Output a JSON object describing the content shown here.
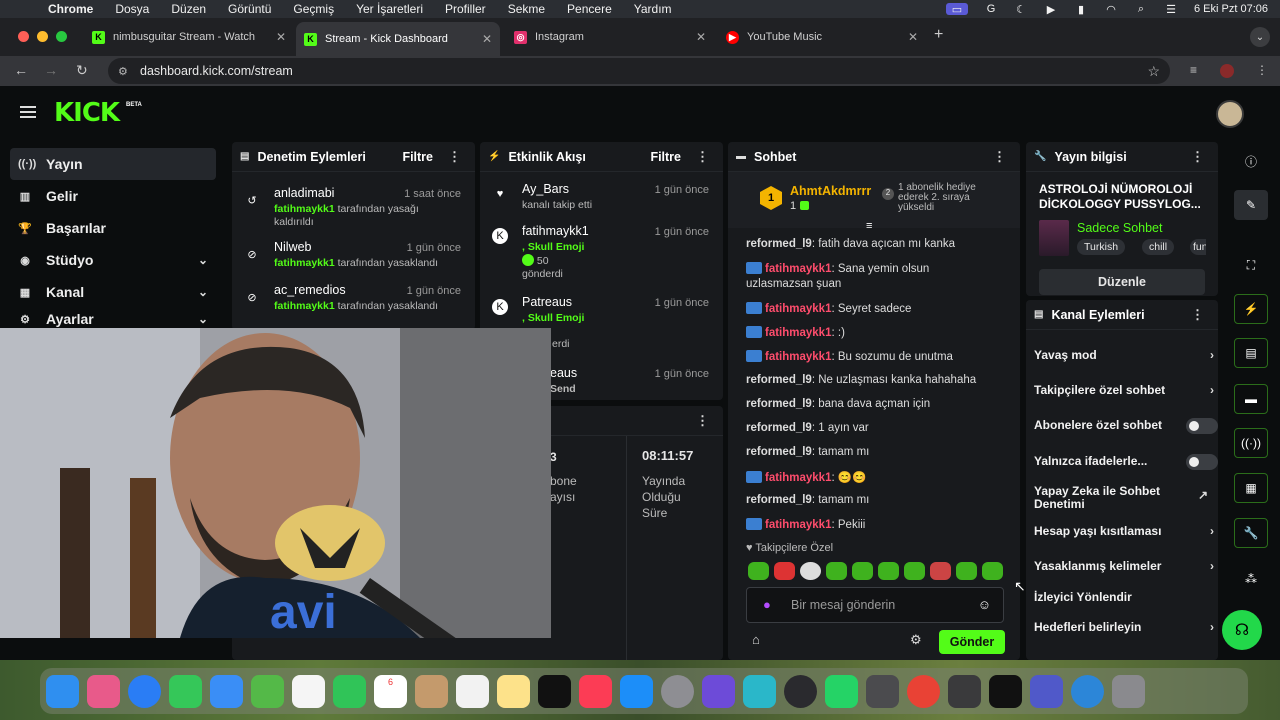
{
  "menubar": {
    "app": "Chrome",
    "items": [
      "Dosya",
      "Düzen",
      "Görüntü",
      "Geçmiş",
      "Yer İşaretleri",
      "Profiller",
      "Sekme",
      "Pencere",
      "Yardım"
    ],
    "datetime": "6 Eki Pzt 07:06"
  },
  "tabs": [
    {
      "title": "nimbusguitar Stream - Watch",
      "favicon": "K",
      "color": "#53fc18"
    },
    {
      "title": "Stream - Kick Dashboard",
      "favicon": "K",
      "color": "#53fc18"
    },
    {
      "title": "Instagram",
      "favicon": "◎",
      "color": "#e1306c"
    },
    {
      "title": "YouTube Music",
      "favicon": "▶",
      "color": "#ff0000"
    }
  ],
  "address": {
    "url": "dashboard.kick.com/stream"
  },
  "brand": {
    "logo": "KICK",
    "beta": "BETA",
    "accent": "#53fc18"
  },
  "sidebar": {
    "items": [
      {
        "label": "Yayın",
        "icon": "broadcast-icon"
      },
      {
        "label": "Gelir",
        "icon": "chart-icon"
      },
      {
        "label": "Başarılar",
        "icon": "trophy-icon"
      },
      {
        "label": "Stüdyo",
        "icon": "studio-icon"
      },
      {
        "label": "Kanal",
        "icon": "channel-icon"
      },
      {
        "label": "Ayarlar",
        "icon": "gear-icon"
      }
    ]
  },
  "moderation": {
    "title": "Denetim Eylemleri",
    "filter": "Filtre",
    "rows": [
      {
        "name": "anladimabi",
        "time": "1 saat önce",
        "actor": "fatihmaykk1",
        "text": " tarafından yasağı kaldırıldı"
      },
      {
        "name": "Nilweb",
        "time": "1 gün önce",
        "actor": "fatihmaykk1",
        "text": " tarafından yasaklandı"
      },
      {
        "name": "ac_remedios",
        "time": "1 gün önce",
        "actor": "fatihmaykk1",
        "text": " tarafından yasaklandı"
      }
    ]
  },
  "activity": {
    "title": "Etkinlik Akışı",
    "filter": "Filtre",
    "rows": [
      {
        "name": "Ay_Bars",
        "time": "1 gün önce",
        "line1": "kanalı takip etti",
        "line2": "",
        "line3": ""
      },
      {
        "name": "fatihmaykk1",
        "time": "1 gün önce",
        "line1": ", Skull Emoji",
        "line2": "50",
        "line3": "gönderdi"
      },
      {
        "name": "Patreaus",
        "time": "1 gün önce",
        "line1": ", Skull Emoji",
        "line2": "",
        "line3": "erdi"
      },
      {
        "name": "eaus",
        "time": "1 gün önce",
        "line1": "Send",
        "line2": "",
        "line3": ""
      }
    ]
  },
  "stats": {
    "a_value": "3",
    "a_label1": "bone",
    "a_label2": "ayısı",
    "time": "08:11:57",
    "time_label1": "Yayında",
    "time_label2": "Olduğu",
    "time_label3": "Süre"
  },
  "chat": {
    "title": "Sohbet",
    "pinned": {
      "user": "AhmtAkdmrrr",
      "count": "1",
      "note": "1 abonelik hediye ederek 2. sıraya yükseldi"
    },
    "messages": [
      {
        "user": "reformed_l9",
        "mod": false,
        "text": ": fatih dava açıcan mı kanka"
      },
      {
        "user": "fatihmaykk1",
        "mod": true,
        "text": ": Sana yemin olsun"
      },
      {
        "user": "",
        "mod": false,
        "text": "uzlasmazsan şuan"
      },
      {
        "user": "fatihmaykk1",
        "mod": true,
        "text": ": Seyret sadece"
      },
      {
        "user": "fatihmaykk1",
        "mod": true,
        "text": ": :)"
      },
      {
        "user": "fatihmaykk1",
        "mod": true,
        "text": ": Bu sozumu de unutma"
      },
      {
        "user": "reformed_l9",
        "mod": false,
        "text": ": Ne uzlaşması kanka hahahaha"
      },
      {
        "user": "reformed_l9",
        "mod": false,
        "text": ": bana dava açman için"
      },
      {
        "user": "reformed_l9",
        "mod": false,
        "text": ": 1 ayın var"
      },
      {
        "user": "reformed_l9",
        "mod": false,
        "text": ": tamam mı"
      },
      {
        "user": "fatihmaykk1",
        "mod": true,
        "text": ": 😊😊"
      },
      {
        "user": "reformed_l9",
        "mod": false,
        "text": ": tamam mı"
      },
      {
        "user": "fatihmaykk1",
        "mod": true,
        "text": ": Pekiii"
      }
    ],
    "mode": "Takipçilere Özel",
    "placeholder": "Bir mesaj gönderin",
    "send": "Gönder"
  },
  "streaminfo": {
    "title": "Yayın bilgisi",
    "stream_title": "ASTROLOJİ NÜMOROLOJİ DİCKOLOGGY PUSSYLOG...",
    "category": "Sadece Sohbet",
    "tags": [
      "Turkish",
      "chill",
      "funr"
    ],
    "edit": "Düzenle"
  },
  "channel_actions": {
    "title": "Kanal Eylemleri",
    "items": [
      {
        "label": "Yavaş mod",
        "kind": "chevron"
      },
      {
        "label": "Takipçilere özel sohbet",
        "kind": "chevron"
      },
      {
        "label": "Abonelere özel sohbet",
        "kind": "toggle"
      },
      {
        "label": "Yalnızca ifadelerle...",
        "kind": "toggle"
      },
      {
        "label": "Yapay Zeka ile Sohbet Denetimi",
        "kind": "link"
      },
      {
        "label": "Hesap yaşı kısıtlaması",
        "kind": "chevron"
      },
      {
        "label": "Yasaklanmış kelimeler",
        "kind": "chevron"
      },
      {
        "label": "İzleyici Yönlendir",
        "kind": "none"
      },
      {
        "label": "Hedefleri belirleyin",
        "kind": "chevron"
      }
    ]
  }
}
